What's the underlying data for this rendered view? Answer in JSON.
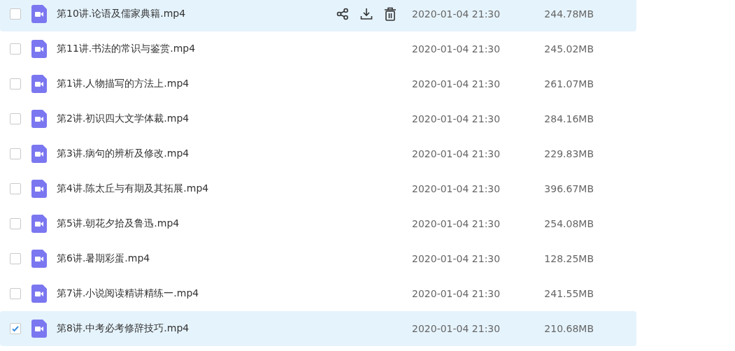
{
  "files": [
    {
      "name": "第10讲.论语及儒家典籍.mp4",
      "modified": "2020-01-04 21:30",
      "size": "244.78MB",
      "selected": false,
      "hovered": true
    },
    {
      "name": "第11讲.书法的常识与鉴赏.mp4",
      "modified": "2020-01-04 21:30",
      "size": "245.02MB",
      "selected": false,
      "hovered": false
    },
    {
      "name": "第1讲.人物描写的方法上.mp4",
      "modified": "2020-01-04 21:30",
      "size": "261.07MB",
      "selected": false,
      "hovered": false
    },
    {
      "name": "第2讲.初识四大文学体裁.mp4",
      "modified": "2020-01-04 21:30",
      "size": "284.16MB",
      "selected": false,
      "hovered": false
    },
    {
      "name": "第3讲.病句的辨析及修改.mp4",
      "modified": "2020-01-04 21:30",
      "size": "229.83MB",
      "selected": false,
      "hovered": false
    },
    {
      "name": "第4讲.陈太丘与有期及其拓展.mp4",
      "modified": "2020-01-04 21:30",
      "size": "396.67MB",
      "selected": false,
      "hovered": false
    },
    {
      "name": "第5讲.朝花夕拾及鲁迅.mp4",
      "modified": "2020-01-04 21:30",
      "size": "254.08MB",
      "selected": false,
      "hovered": false
    },
    {
      "name": "第6讲.暑期彩蛋.mp4",
      "modified": "2020-01-04 21:30",
      "size": "128.25MB",
      "selected": false,
      "hovered": false
    },
    {
      "name": "第7讲.小说阅读精讲精练一.mp4",
      "modified": "2020-01-04 21:30",
      "size": "241.55MB",
      "selected": false,
      "hovered": false
    },
    {
      "name": "第8讲.中考必考修辞技巧.mp4",
      "modified": "2020-01-04 21:30",
      "size": "210.68MB",
      "selected": true,
      "hovered": false
    }
  ]
}
